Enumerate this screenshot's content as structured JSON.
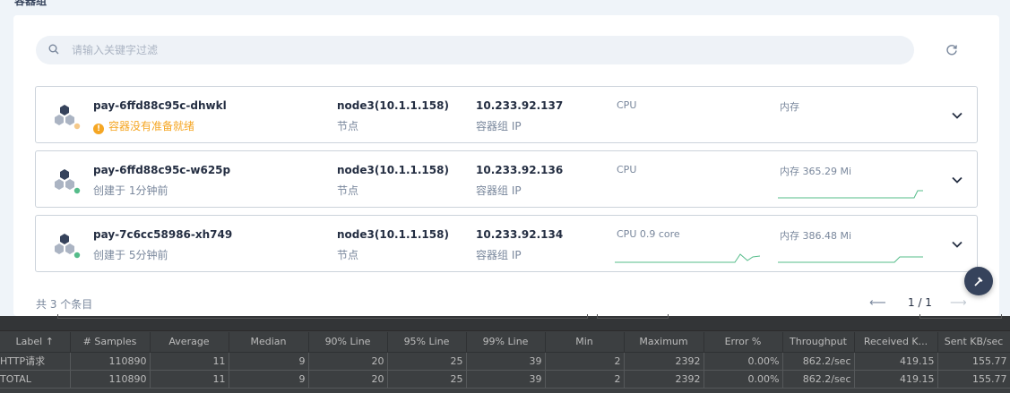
{
  "header": {
    "title": "容器组"
  },
  "search": {
    "placeholder": "请输入关键字过滤"
  },
  "pods": [
    {
      "name": "pay-6ffd88c95c-dhwkl",
      "status": "容器没有准备就绪",
      "status_type": "warning",
      "node": "node3(10.1.1.158)",
      "node_label": "节点",
      "ip": "10.233.92.137",
      "ip_label": "容器组 IP",
      "cpu_label": "CPU",
      "mem_label": "内存"
    },
    {
      "name": "pay-6ffd88c95c-w625p",
      "status": "创建于 1分钟前",
      "status_type": "running",
      "node": "node3(10.1.1.158)",
      "node_label": "节点",
      "ip": "10.233.92.136",
      "ip_label": "容器组 IP",
      "cpu_label": "CPU",
      "mem_label": "内存 365.29 Mi"
    },
    {
      "name": "pay-7c6cc58986-xh749",
      "status": "创建于 5分钟前",
      "status_type": "running",
      "node": "node3(10.1.1.158)",
      "node_label": "节点",
      "ip": "10.233.92.134",
      "ip_label": "容器组 IP",
      "cpu_label": "CPU 0.9 core",
      "mem_label": "内存 386.48 Mi"
    }
  ],
  "footer": {
    "total": "共 3 个条目",
    "page": "1 / 1",
    "prev": "⟵",
    "next": "⟶"
  },
  "colors": {
    "warning": "#f5a623",
    "running": "#55bc8a",
    "primary_text": "#242e42",
    "secondary_text": "#79879c",
    "fab": "#36435c"
  },
  "icons": {
    "search": "search-icon",
    "refresh": "refresh-icon",
    "pod": "pod-icon",
    "expand": "chevron-down-icon",
    "fab": "hammer-icon"
  },
  "jmeter": {
    "columns": [
      "Label ↑",
      "# Samples",
      "Average",
      "Median",
      "90% Line",
      "95% Line",
      "99% Line",
      "Min",
      "Maximum",
      "Error %",
      "Throughput",
      "Received K...",
      "Sent KB/sec"
    ],
    "rows": [
      [
        "HTTP请求",
        "110890",
        "11",
        "9",
        "20",
        "25",
        "39",
        "2",
        "2392",
        "0.00%",
        "862.2/sec",
        "419.15",
        "155.77"
      ],
      [
        "TOTAL",
        "110890",
        "11",
        "9",
        "20",
        "25",
        "39",
        "2",
        "2392",
        "0.00%",
        "862.2/sec",
        "419.15",
        "155.77"
      ]
    ]
  }
}
